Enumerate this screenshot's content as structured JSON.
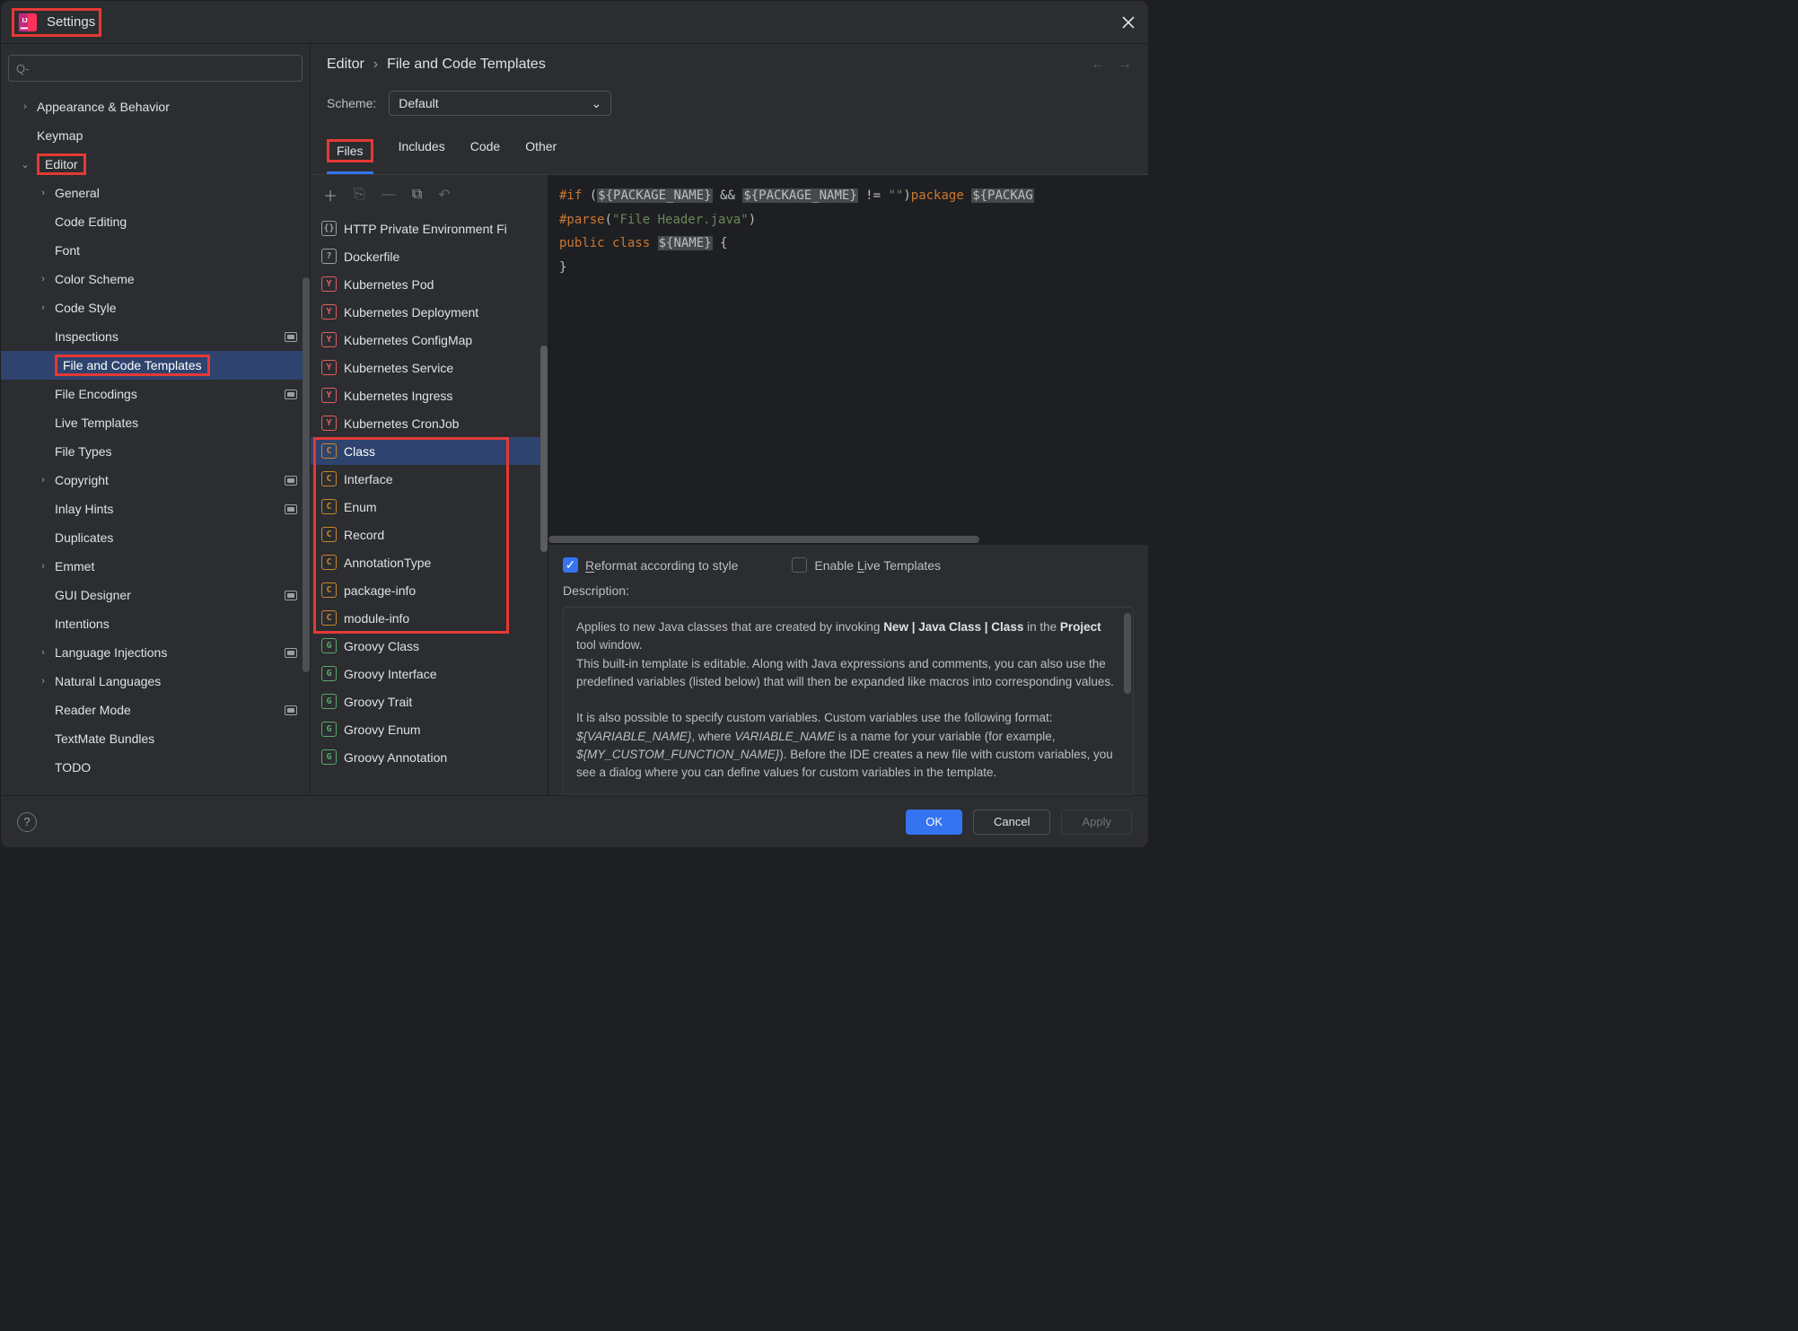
{
  "window": {
    "title": "Settings"
  },
  "breadcrumb": {
    "a": "Editor",
    "b": "File and Code Templates"
  },
  "scheme": {
    "label": "Scheme:",
    "value": "Default"
  },
  "tabs": [
    "Files",
    "Includes",
    "Code",
    "Other"
  ],
  "sidebar": {
    "items": [
      {
        "label": "Appearance & Behavior",
        "chev": "right",
        "indent": 0
      },
      {
        "label": "Keymap",
        "indent": 0
      },
      {
        "label": "Editor",
        "chev": "down",
        "indent": 0,
        "box": true
      },
      {
        "label": "General",
        "chev": "right",
        "indent": 1
      },
      {
        "label": "Code Editing",
        "indent": 1
      },
      {
        "label": "Font",
        "indent": 1
      },
      {
        "label": "Color Scheme",
        "chev": "right",
        "indent": 1
      },
      {
        "label": "Code Style",
        "chev": "right",
        "indent": 1
      },
      {
        "label": "Inspections",
        "indent": 1,
        "badge": true
      },
      {
        "label": "File and Code Templates",
        "indent": 1,
        "selected": true,
        "box": true
      },
      {
        "label": "File Encodings",
        "indent": 1,
        "badge": true
      },
      {
        "label": "Live Templates",
        "indent": 1
      },
      {
        "label": "File Types",
        "indent": 1
      },
      {
        "label": "Copyright",
        "chev": "right",
        "indent": 1,
        "badge": true
      },
      {
        "label": "Inlay Hints",
        "indent": 1,
        "badge": true
      },
      {
        "label": "Duplicates",
        "indent": 1
      },
      {
        "label": "Emmet",
        "chev": "right",
        "indent": 1
      },
      {
        "label": "GUI Designer",
        "indent": 1,
        "badge": true
      },
      {
        "label": "Intentions",
        "indent": 1
      },
      {
        "label": "Language Injections",
        "chev": "right",
        "indent": 1,
        "badge": true
      },
      {
        "label": "Natural Languages",
        "chev": "right",
        "indent": 1
      },
      {
        "label": "Reader Mode",
        "indent": 1,
        "badge": true
      },
      {
        "label": "TextMate Bundles",
        "indent": 1
      },
      {
        "label": "TODO",
        "indent": 1
      }
    ]
  },
  "templates": [
    {
      "label": "HTTP Private Environment Fi",
      "icon": "braces",
      "glyph": "{}"
    },
    {
      "label": "Dockerfile",
      "icon": "q",
      "glyph": "?"
    },
    {
      "label": "Kubernetes Pod",
      "icon": "y",
      "glyph": "Y"
    },
    {
      "label": "Kubernetes Deployment",
      "icon": "y",
      "glyph": "Y"
    },
    {
      "label": "Kubernetes ConfigMap",
      "icon": "y",
      "glyph": "Y"
    },
    {
      "label": "Kubernetes Service",
      "icon": "y",
      "glyph": "Y"
    },
    {
      "label": "Kubernetes Ingress",
      "icon": "y",
      "glyph": "Y"
    },
    {
      "label": "Kubernetes CronJob",
      "icon": "y",
      "glyph": "Y"
    },
    {
      "label": "Class",
      "icon": "c",
      "glyph": "C",
      "selected": true
    },
    {
      "label": "Interface",
      "icon": "c",
      "glyph": "C"
    },
    {
      "label": "Enum",
      "icon": "c",
      "glyph": "C"
    },
    {
      "label": "Record",
      "icon": "c",
      "glyph": "C"
    },
    {
      "label": "AnnotationType",
      "icon": "c",
      "glyph": "C"
    },
    {
      "label": "package-info",
      "icon": "c",
      "glyph": "C"
    },
    {
      "label": "module-info",
      "icon": "c",
      "glyph": "C"
    },
    {
      "label": "Groovy Class",
      "icon": "g",
      "glyph": "G"
    },
    {
      "label": "Groovy Interface",
      "icon": "g",
      "glyph": "G"
    },
    {
      "label": "Groovy Trait",
      "icon": "g",
      "glyph": "G"
    },
    {
      "label": "Groovy Enum",
      "icon": "g",
      "glyph": "G"
    },
    {
      "label": "Groovy Annotation",
      "icon": "g",
      "glyph": "G"
    }
  ],
  "code": {
    "line1": {
      "kw": "#if",
      "open": " (",
      "v1": "${PACKAGE_NAME}",
      "mid": " && ",
      "v2": "${PACKAGE_NAME}",
      "neq": " != ",
      "empty": "\"\"",
      "close": ")",
      "pkg": "package ",
      "v3": "${PACKAG"
    },
    "line2": {
      "kw": "#parse",
      "open": "(",
      "file": "\"File Header.java\"",
      "close": ")"
    },
    "line3": {
      "pub": "public ",
      "cls": "class ",
      "name": "${NAME}",
      "brace": " {"
    },
    "line4": "}"
  },
  "options": {
    "reformat": {
      "prefix": "R",
      "rest": "eformat according to style",
      "checked": true
    },
    "live": {
      "prefix": "Enable ",
      "u": "L",
      "rest": "ive Templates",
      "checked": false
    }
  },
  "description": {
    "label": "Description:",
    "p1a": "Applies to new Java classes that are created by invoking ",
    "p1b": "New | Java Class | Class",
    "p1c": " in the ",
    "p1d": "Project",
    "p1e": " tool window.",
    "p2": "This built-in template is editable. Along with Java expressions and comments, you can also use the predefined variables (listed below) that will then be expanded like macros into corresponding values.",
    "p3a": "It is also possible to specify custom variables. Custom variables use the following format: ",
    "p3b": "${VARIABLE_NAME}",
    "p3c": ", where ",
    "p3d": "VARIABLE_NAME",
    "p3e": " is a name for your variable (for example, ",
    "p3f": "${MY_CUSTOM_FUNCTION_NAME}",
    "p3g": "). Before the IDE creates a new file with custom variables, you see a dialog where you can define values for custom variables in the template."
  },
  "footer": {
    "ok": "OK",
    "cancel": "Cancel",
    "apply": "Apply"
  }
}
